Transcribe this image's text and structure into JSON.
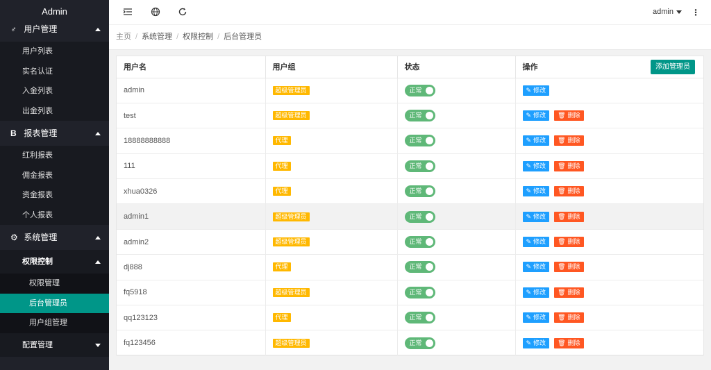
{
  "app_title": "Admin",
  "sidebar": {
    "top_group": {
      "label": "用户管理",
      "icon": "user-icon"
    },
    "user_items": [
      "用户列表",
      "实名认证",
      "入金列表",
      "出金列表"
    ],
    "report_group": {
      "label": "报表管理",
      "glyph": "B"
    },
    "report_items": [
      "红利报表",
      "佣金报表",
      "资金报表",
      "个人报表"
    ],
    "system_group": {
      "label": "系统管理",
      "icon": "gear-icon"
    },
    "perm_group": {
      "label": "权限控制"
    },
    "perm_items": [
      "权限管理",
      "后台管理员",
      "用户组管理"
    ],
    "config_group": {
      "label": "配置管理"
    }
  },
  "header": {
    "user_name": "admin",
    "icons": [
      "menu-fold-icon",
      "globe-icon",
      "refresh-icon",
      "more-vertical-icon"
    ]
  },
  "breadcrumb": [
    "主页",
    "系统管理",
    "权限控制",
    "后台管理员"
  ],
  "table": {
    "columns": [
      "用户名",
      "用户组",
      "状态",
      "操作"
    ],
    "add_button": "添加管理员",
    "status_label": "正常",
    "edit_label": "修改",
    "delete_label": "删除",
    "rows": [
      {
        "username": "admin",
        "group": "超级管理员",
        "deletable": false
      },
      {
        "username": "test",
        "group": "超级管理员",
        "deletable": true
      },
      {
        "username": "18888888888",
        "group": "代理",
        "deletable": true
      },
      {
        "username": "111",
        "group": "代理",
        "deletable": true
      },
      {
        "username": "xhua0326",
        "group": "代理",
        "deletable": true
      },
      {
        "username": "admin1",
        "group": "超级管理员",
        "deletable": true,
        "highlighted": true
      },
      {
        "username": "admin2",
        "group": "超级管理员",
        "deletable": true
      },
      {
        "username": "dj888",
        "group": "代理",
        "deletable": true
      },
      {
        "username": "fq5918",
        "group": "超级管理员",
        "deletable": true
      },
      {
        "username": "qq123123",
        "group": "代理",
        "deletable": true
      },
      {
        "username": "fq123456",
        "group": "超级管理员",
        "deletable": true
      }
    ]
  },
  "colors": {
    "sidebar_bg": "#20222a",
    "active": "#009688",
    "badge": "#ffb800",
    "switch_on": "#5fb878",
    "edit": "#1e9fff",
    "delete": "#ff5722"
  }
}
